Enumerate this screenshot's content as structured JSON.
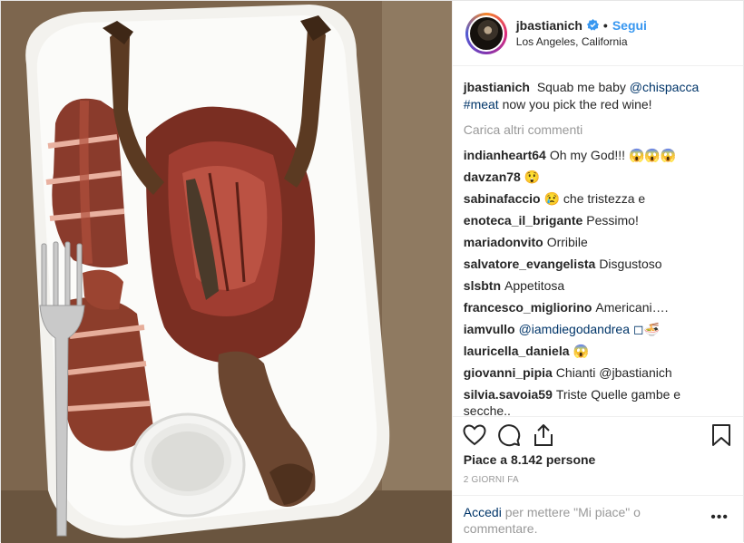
{
  "post": {
    "username": "jbastianich",
    "verified": true,
    "separator": "•",
    "follow_label": "Segui",
    "location": "Los Angeles, California"
  },
  "caption": {
    "username": "jbastianich",
    "text_before": "Squab me baby",
    "mention": "@chispacca",
    "hashtag": "#meat",
    "text_after": "now you pick the red wine!"
  },
  "load_more": "Carica altri commenti",
  "comments": [
    {
      "user": "indianheart64",
      "text": "Oh my God!!! 😱😱😱"
    },
    {
      "user": "davzan78",
      "text": "😲"
    },
    {
      "user": "sabinafaccio",
      "text": "😢 che tristezza e"
    },
    {
      "user": "enoteca_il_brigante",
      "text": "Pessimo!"
    },
    {
      "user": "mariadonvito",
      "text": "Orribile"
    },
    {
      "user": "salvatore_evangelista",
      "text": "Disgustoso"
    },
    {
      "user": "slsbtn",
      "text": "Appetitosa"
    },
    {
      "user": "francesco_migliorino",
      "text": "Americani…."
    },
    {
      "user": "iamvullo",
      "text": "@iamdiegodandrea ◻🍜"
    },
    {
      "user": "lauricella_daniela",
      "text": "😱"
    },
    {
      "user": "giovanni_pipia",
      "text": "Chianti @jbastianich"
    },
    {
      "user": "silvia.savoia59",
      "text": "Triste Quelle gambe e secche.."
    }
  ],
  "actions": {
    "like": "heart-icon",
    "comment": "comment-icon",
    "share": "share-icon",
    "save": "bookmark-icon"
  },
  "likes": {
    "prefix": "Piace a",
    "count": "8.142",
    "suffix": "persone"
  },
  "timestamp": "2 GIORNI FA",
  "footer": {
    "login_label": "Accedi",
    "text": "per mettere \"Mi piace\" o commentare.",
    "more_label": "•••"
  },
  "colors": {
    "link": "#003569",
    "follow": "#3897f0",
    "muted": "#999999",
    "verified": "#3897f0"
  }
}
